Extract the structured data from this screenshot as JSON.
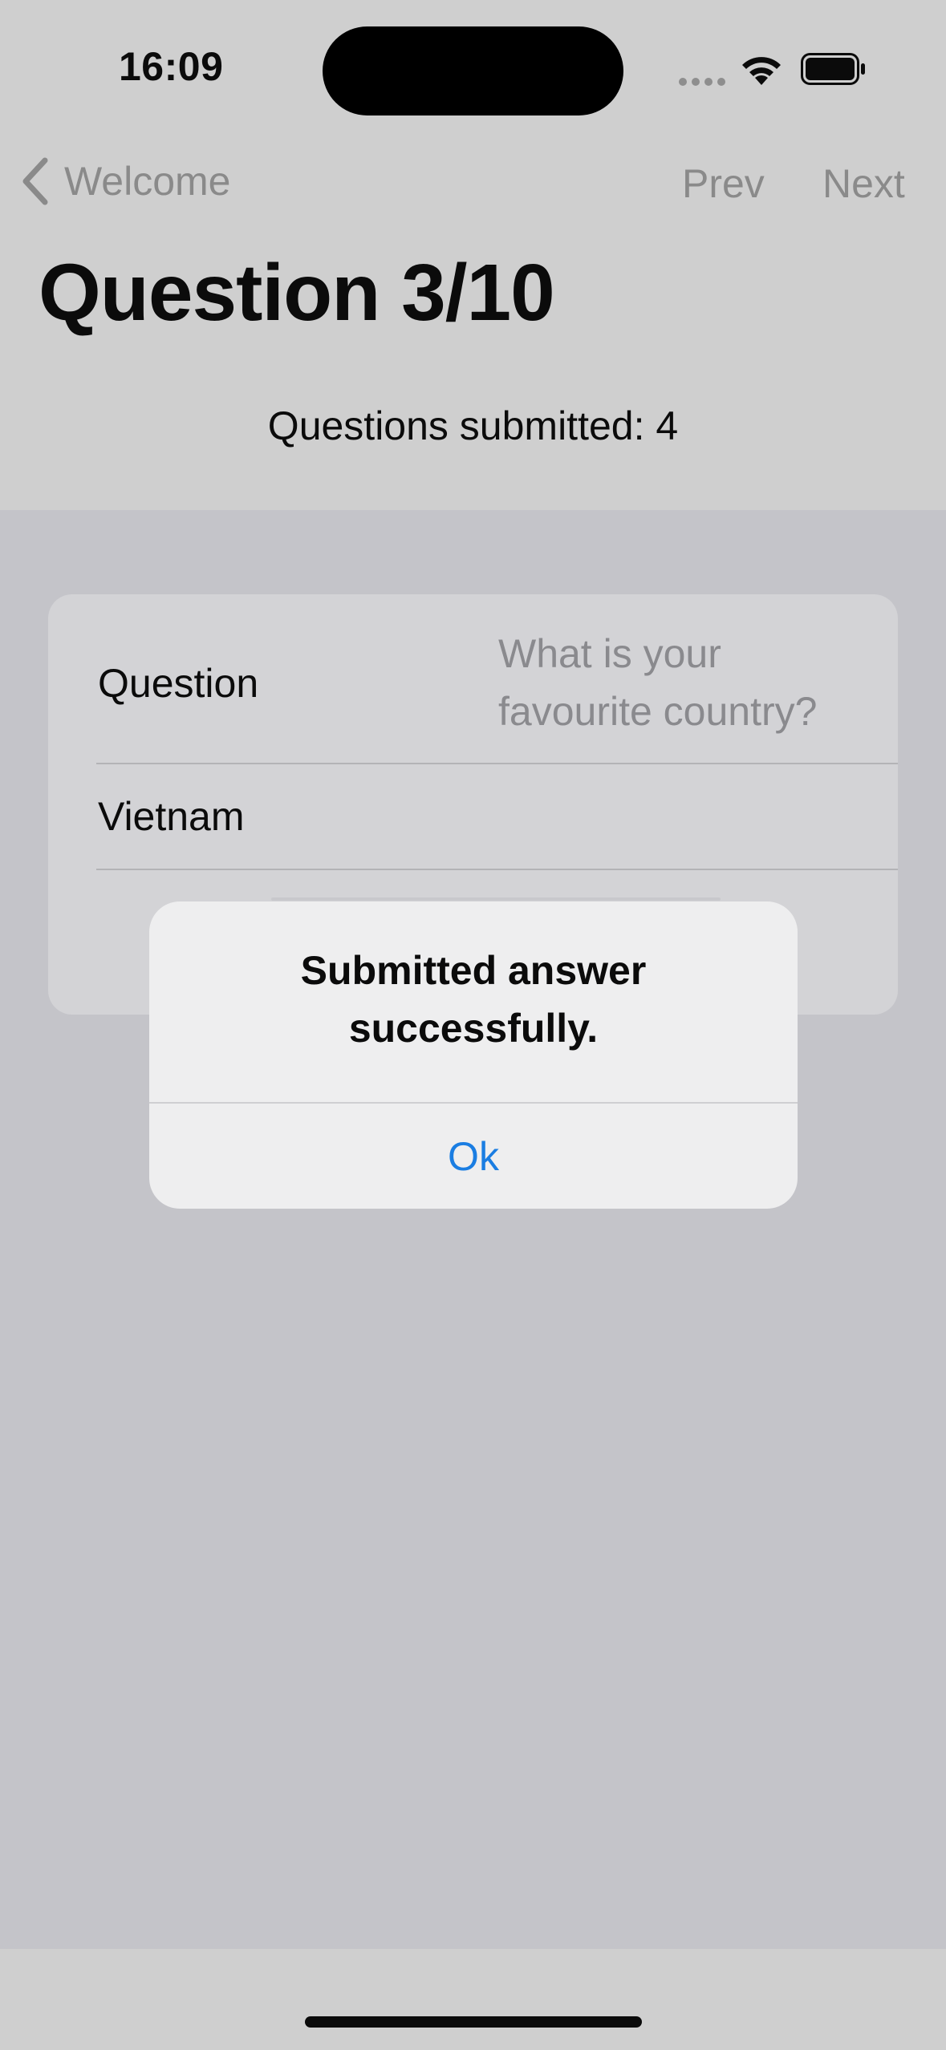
{
  "status_bar": {
    "time": "16:09",
    "icons": [
      "signal-dots-icon",
      "wifi-icon",
      "battery-icon"
    ]
  },
  "nav": {
    "back_label": "Welcome",
    "prev_label": "Prev",
    "next_label": "Next"
  },
  "page": {
    "title": "Question 3/10",
    "submitted_text": "Questions submitted: 4"
  },
  "form": {
    "question_label": "Question",
    "question_value": "What is your favourite country?",
    "answer_value": "Vietnam"
  },
  "alert": {
    "title": "Submitted answer successfully.",
    "ok_label": "Ok"
  },
  "colors": {
    "accent": "#1a7de2",
    "dimmed_text": "#8a8a8a"
  }
}
